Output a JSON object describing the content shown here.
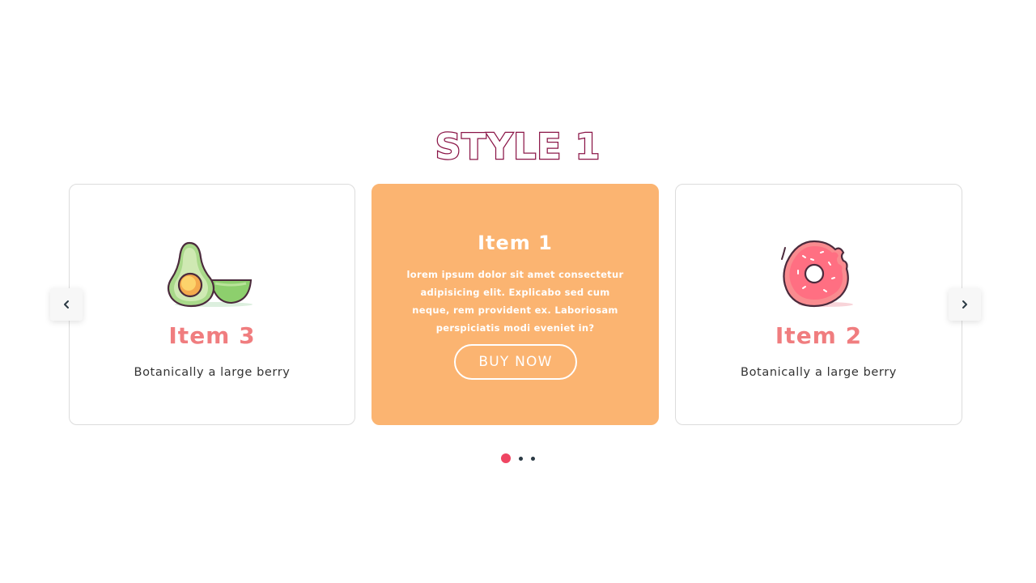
{
  "page": {
    "title": "STYLE 1"
  },
  "carousel": {
    "cards": [
      {
        "title": "Item 3",
        "description": "Botanically a large berry",
        "icon": "avocado-icon"
      },
      {
        "title": "Item 1",
        "body": "lorem ipsum dolor sit amet consectetur adipisicing elit. Explicabo sed cum neque, rem provident ex. Laboriosam perspiciatis modi eveniet in?",
        "button_label": "BUY NOW"
      },
      {
        "title": "Item 2",
        "description": "Botanically a large berry",
        "icon": "donut-icon"
      }
    ],
    "prev_icon": "chevron-left-icon",
    "next_icon": "chevron-right-icon",
    "pagination": {
      "count": 3,
      "active_index": 0
    }
  },
  "colors": {
    "title_stroke": "#8a1446",
    "active_card": "#fbb471",
    "card_title": "#f07d7f",
    "active_dot": "#ef4562",
    "dot": "#2b3a44"
  }
}
